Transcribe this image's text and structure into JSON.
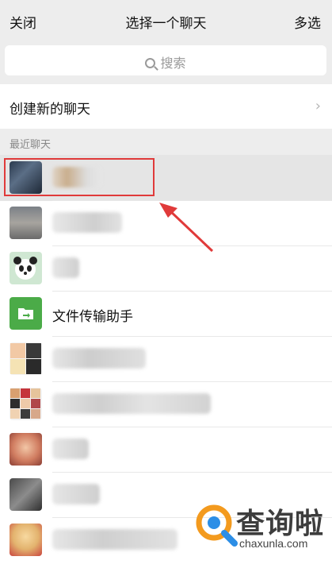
{
  "header": {
    "left_label": "关闭",
    "title": "选择一个聊天",
    "right_label": "多选"
  },
  "search": {
    "placeholder": "搜索"
  },
  "create_chat": {
    "label": "创建新的聊天",
    "chevron": "›"
  },
  "section": {
    "label": "最近聊天"
  },
  "contacts": [
    {
      "name": "",
      "avatar": "photo-avatar",
      "selected": true
    },
    {
      "name": "",
      "avatar": "photo-avatar"
    },
    {
      "name": "",
      "avatar": "panda-avatar"
    },
    {
      "name": "文件传输助手",
      "avatar": "file-transfer-icon"
    },
    {
      "name": "",
      "avatar": "group-avatar"
    },
    {
      "name": "",
      "avatar": "group-avatar"
    },
    {
      "name": "",
      "avatar": "photo-avatar"
    },
    {
      "name": "",
      "avatar": "photo-avatar"
    },
    {
      "name": "",
      "avatar": "photo-avatar"
    }
  ],
  "watermark": {
    "title": "查询啦",
    "url": "chaxunla.com"
  },
  "colors": {
    "accent_red": "#e03a3a",
    "file_green": "#4bab48",
    "logo_orange": "#f39a1e",
    "logo_blue": "#2c8ee6"
  }
}
